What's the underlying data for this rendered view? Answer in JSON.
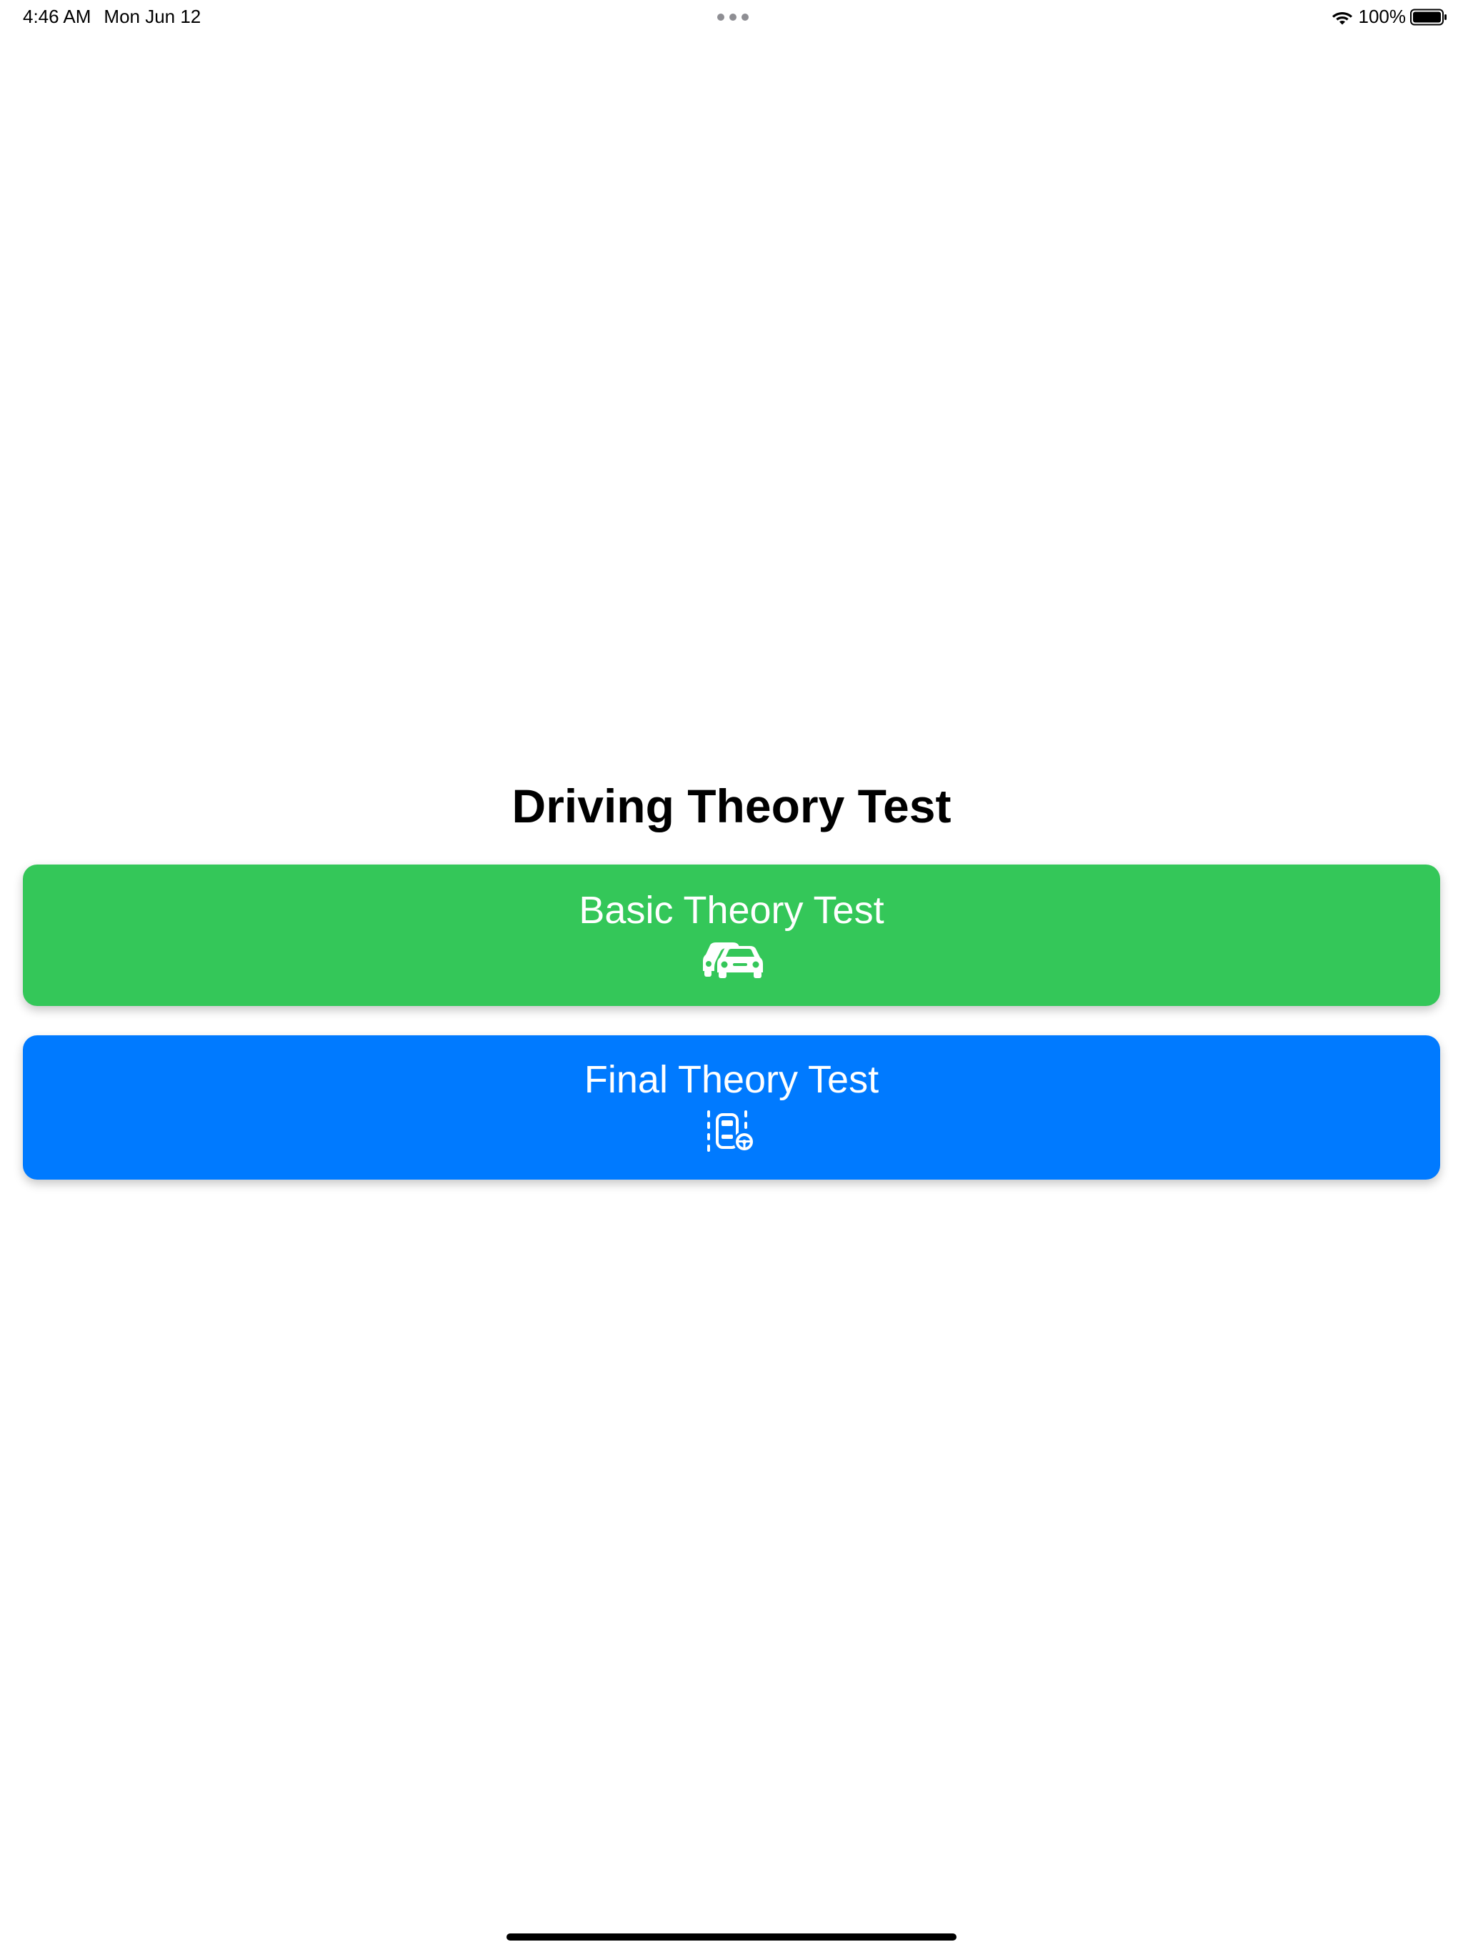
{
  "status_bar": {
    "time": "4:46 AM",
    "date": "Mon Jun 12",
    "battery_percent": "100%",
    "battery_level": 1.0
  },
  "page": {
    "title": "Driving Theory Test"
  },
  "buttons": {
    "basic": {
      "label": "Basic Theory Test",
      "icon": "two-cars-icon",
      "color": "#34C759"
    },
    "final": {
      "label": "Final Theory Test",
      "icon": "car-lane-steering-icon",
      "color": "#007AFF"
    }
  }
}
